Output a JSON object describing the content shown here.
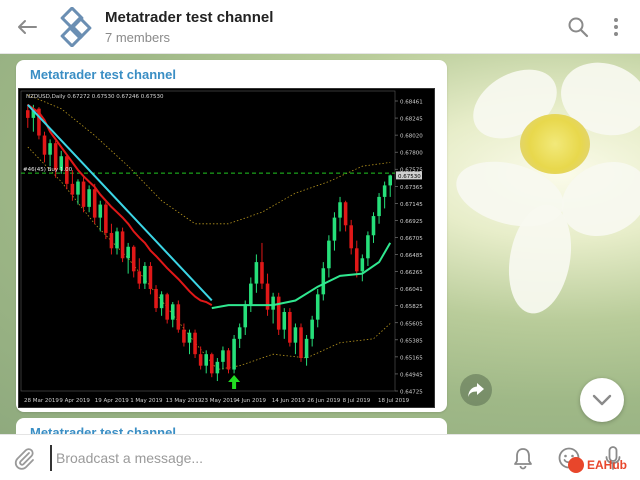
{
  "header": {
    "title": "Metatrader test channel",
    "subtitle": "7 members"
  },
  "message": {
    "author": "Metatrader test channel"
  },
  "message2": {
    "author": "Metatrader test channel"
  },
  "composer": {
    "placeholder": "Broadcast a message..."
  },
  "watermark": "EAHub",
  "chart_data": {
    "type": "candlestick",
    "title": "NZDUSD,Daily  0.67272 0.67530 0.67246 0.67530",
    "annotation": "#46(45) Buy 1.00",
    "current_price": "0.67530",
    "y_ticks": [
      "0.68461",
      "0.68245",
      "0.68020",
      "0.67800",
      "0.67575",
      "0.67365",
      "0.67145",
      "0.66925",
      "0.66705",
      "0.66485",
      "0.66265",
      "0.66041",
      "0.65825",
      "0.65605",
      "0.65385",
      "0.65165",
      "0.64945",
      "0.64725"
    ],
    "x_ticks": [
      "28 Mar 2019",
      "9 Apr 2019",
      "19 Apr 2019",
      "1 May 2019",
      "13 May 2019",
      "23 May 2019",
      "4 Jun 2019",
      "14 Jun 2019",
      "26 Jun 2019",
      "8 Jul 2019",
      "18 Jul 2019"
    ],
    "ylim": [
      0.6472,
      0.685
    ],
    "colors": {
      "bull": "#26e07a",
      "bear": "#e01818",
      "trend": "#3cd6e6",
      "stop_line": "#e01818",
      "ma": "#30e890",
      "envelope": "#b8961e",
      "level": "#22c722",
      "background": "#000000"
    },
    "candles": [
      [
        0.6838,
        0.6846,
        0.6815,
        0.6828
      ],
      [
        0.6828,
        0.6845,
        0.681,
        0.684
      ],
      [
        0.684,
        0.6842,
        0.68,
        0.6805
      ],
      [
        0.6805,
        0.681,
        0.677,
        0.678
      ],
      [
        0.678,
        0.68,
        0.6765,
        0.6795
      ],
      [
        0.6795,
        0.6798,
        0.675,
        0.676
      ],
      [
        0.676,
        0.6785,
        0.6755,
        0.6778
      ],
      [
        0.6778,
        0.678,
        0.6735,
        0.6742
      ],
      [
        0.6742,
        0.676,
        0.672,
        0.6728
      ],
      [
        0.6728,
        0.6748,
        0.6715,
        0.6745
      ],
      [
        0.6745,
        0.6752,
        0.6705,
        0.6712
      ],
      [
        0.6712,
        0.674,
        0.6705,
        0.6735
      ],
      [
        0.6735,
        0.6742,
        0.669,
        0.6698
      ],
      [
        0.6698,
        0.672,
        0.668,
        0.6715
      ],
      [
        0.6715,
        0.6718,
        0.667,
        0.6678
      ],
      [
        0.6678,
        0.669,
        0.665,
        0.6658
      ],
      [
        0.6658,
        0.6685,
        0.665,
        0.668
      ],
      [
        0.668,
        0.6685,
        0.664,
        0.6645
      ],
      [
        0.6645,
        0.6665,
        0.6625,
        0.666
      ],
      [
        0.666,
        0.6662,
        0.662,
        0.6628
      ],
      [
        0.6628,
        0.6645,
        0.6605,
        0.6612
      ],
      [
        0.6612,
        0.664,
        0.6605,
        0.6635
      ],
      [
        0.6635,
        0.664,
        0.6598,
        0.6605
      ],
      [
        0.6605,
        0.661,
        0.6575,
        0.658
      ],
      [
        0.658,
        0.6602,
        0.657,
        0.6598
      ],
      [
        0.6598,
        0.66,
        0.656,
        0.6565
      ],
      [
        0.6565,
        0.6588,
        0.6555,
        0.6585
      ],
      [
        0.6585,
        0.659,
        0.6548,
        0.6552
      ],
      [
        0.6552,
        0.656,
        0.653,
        0.6535
      ],
      [
        0.6535,
        0.6552,
        0.652,
        0.6548
      ],
      [
        0.6548,
        0.6552,
        0.6515,
        0.652
      ],
      [
        0.652,
        0.653,
        0.65,
        0.6505
      ],
      [
        0.6505,
        0.6525,
        0.6495,
        0.652
      ],
      [
        0.652,
        0.6522,
        0.649,
        0.6495
      ],
      [
        0.6495,
        0.6515,
        0.6485,
        0.651
      ],
      [
        0.651,
        0.653,
        0.65,
        0.6525
      ],
      [
        0.6525,
        0.6528,
        0.6495,
        0.65
      ],
      [
        0.65,
        0.6545,
        0.6495,
        0.654
      ],
      [
        0.654,
        0.656,
        0.6528,
        0.6555
      ],
      [
        0.6555,
        0.659,
        0.6545,
        0.6585
      ],
      [
        0.6585,
        0.662,
        0.6575,
        0.6612
      ],
      [
        0.6612,
        0.665,
        0.66,
        0.664
      ],
      [
        0.664,
        0.6665,
        0.6605,
        0.6612
      ],
      [
        0.6612,
        0.6625,
        0.657,
        0.6578
      ],
      [
        0.6578,
        0.66,
        0.656,
        0.6595
      ],
      [
        0.6595,
        0.66,
        0.6545,
        0.6552
      ],
      [
        0.6552,
        0.658,
        0.654,
        0.6575
      ],
      [
        0.6575,
        0.658,
        0.653,
        0.6535
      ],
      [
        0.6535,
        0.656,
        0.652,
        0.6555
      ],
      [
        0.6555,
        0.656,
        0.651,
        0.6515
      ],
      [
        0.6515,
        0.6545,
        0.6505,
        0.654
      ],
      [
        0.654,
        0.657,
        0.653,
        0.6565
      ],
      [
        0.6565,
        0.6605,
        0.6555,
        0.6598
      ],
      [
        0.6598,
        0.664,
        0.659,
        0.6632
      ],
      [
        0.6632,
        0.6675,
        0.662,
        0.6668
      ],
      [
        0.6668,
        0.6705,
        0.6655,
        0.6698
      ],
      [
        0.6698,
        0.6725,
        0.668,
        0.6718
      ],
      [
        0.6718,
        0.672,
        0.668,
        0.6688
      ],
      [
        0.6688,
        0.6695,
        0.665,
        0.6658
      ],
      [
        0.6658,
        0.6668,
        0.662,
        0.6628
      ],
      [
        0.6628,
        0.665,
        0.6615,
        0.6645
      ],
      [
        0.6645,
        0.668,
        0.6635,
        0.6675
      ],
      [
        0.6675,
        0.6705,
        0.6665,
        0.67
      ],
      [
        0.67,
        0.673,
        0.669,
        0.6725
      ],
      [
        0.6725,
        0.6745,
        0.671,
        0.674
      ],
      [
        0.674,
        0.6754,
        0.6725,
        0.6753
      ]
    ],
    "trend_line": [
      [
        0,
        0.6845
      ],
      [
        33,
        0.659
      ]
    ],
    "stop_line": [
      0.6845,
      0.684,
      0.6835,
      0.6825,
      0.681,
      0.68,
      0.679,
      0.678,
      0.677,
      0.676,
      0.6752,
      0.6745,
      0.6738,
      0.6728,
      0.672,
      0.6712,
      0.6705,
      0.6698,
      0.669,
      0.668,
      0.6672,
      0.6665,
      0.6655,
      0.6648,
      0.664,
      0.6632,
      0.6625,
      0.6618,
      0.661,
      0.6602,
      0.6595,
      0.659,
      0.6588,
      0.6584
    ],
    "ma_line": [
      [
        33,
        0.658
      ],
      [
        36,
        0.6584
      ],
      [
        40,
        0.6584
      ],
      [
        44,
        0.6584
      ],
      [
        48,
        0.659
      ],
      [
        52,
        0.6608
      ],
      [
        56,
        0.6622
      ],
      [
        60,
        0.6625
      ],
      [
        63,
        0.664
      ],
      [
        65,
        0.6665
      ]
    ],
    "envelope_upper": [
      [
        0,
        0.6858
      ],
      [
        6,
        0.684
      ],
      [
        12,
        0.6805
      ],
      [
        18,
        0.6765
      ],
      [
        24,
        0.672
      ],
      [
        30,
        0.669
      ],
      [
        36,
        0.669
      ],
      [
        42,
        0.6705
      ],
      [
        48,
        0.673
      ],
      [
        54,
        0.6745
      ],
      [
        60,
        0.6765
      ],
      [
        65,
        0.677
      ]
    ],
    "envelope_lower": [
      [
        0,
        0.679
      ],
      [
        6,
        0.6745
      ],
      [
        12,
        0.669
      ],
      [
        18,
        0.6645
      ],
      [
        24,
        0.659
      ],
      [
        30,
        0.6535
      ],
      [
        34,
        0.65
      ],
      [
        38,
        0.6505
      ],
      [
        44,
        0.652
      ],
      [
        50,
        0.6515
      ],
      [
        56,
        0.6535
      ],
      [
        62,
        0.654
      ],
      [
        65,
        0.656
      ]
    ],
    "level_line": 0.6756,
    "buy_arrow_index": 37
  }
}
